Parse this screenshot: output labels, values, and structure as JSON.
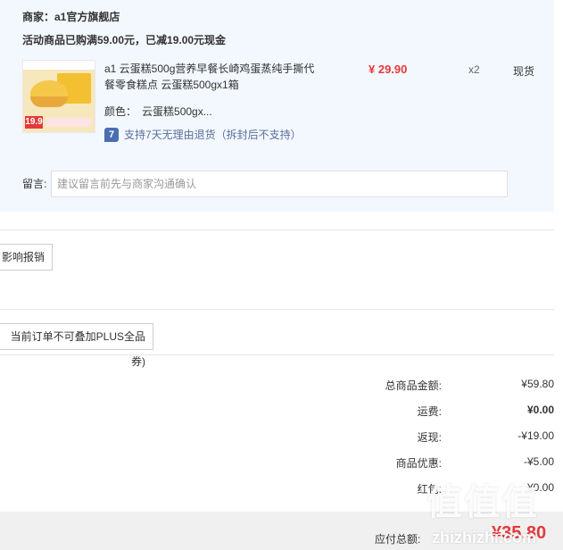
{
  "merchant": {
    "label": "商家：a1官方旗舰店"
  },
  "promo": {
    "text": "活动商品已购满59.00元，已减19.00元现金"
  },
  "product": {
    "thumb_price": "19.9",
    "title": "a1 云蛋糕500g营养早餐长崎鸡蛋蒸纯手撕代餐零食糕点 云蛋糕500gx1箱",
    "price": "¥ 29.90",
    "quantity": "x2",
    "stock": "现货",
    "color_label": "颜色：",
    "color_value": "云蛋糕500gx...",
    "return_icon": "7",
    "return_policy": "支持7天无理由退货（拆封后不支持）"
  },
  "note": {
    "label": "留言:",
    "placeholder": "建议留言前先与商家沟通确认"
  },
  "buttons": {
    "reimburse": "影响报销",
    "plus_notice": "当前订单不可叠加PLUS全品券)"
  },
  "summary": [
    {
      "label": "总商品金额:",
      "value": "¥59.80",
      "bold": false
    },
    {
      "label": "运费:",
      "value": "¥0.00",
      "bold": true
    },
    {
      "label": "返现:",
      "value": "-¥19.00",
      "bold": false
    },
    {
      "label": "商品优惠:",
      "value": "-¥5.00",
      "bold": false
    },
    {
      "label": "红包:",
      "value": "¥0.00",
      "bold": false
    }
  ],
  "payable": {
    "label": "应付总额:",
    "value": "¥35.80"
  },
  "watermark": {
    "main": "值值值",
    "sub": "zhizhizhi.com"
  },
  "colors": {
    "panel_bg": "#f3f8fe",
    "price_red": "#e4393c",
    "return_blue": "#5a6e9a"
  }
}
